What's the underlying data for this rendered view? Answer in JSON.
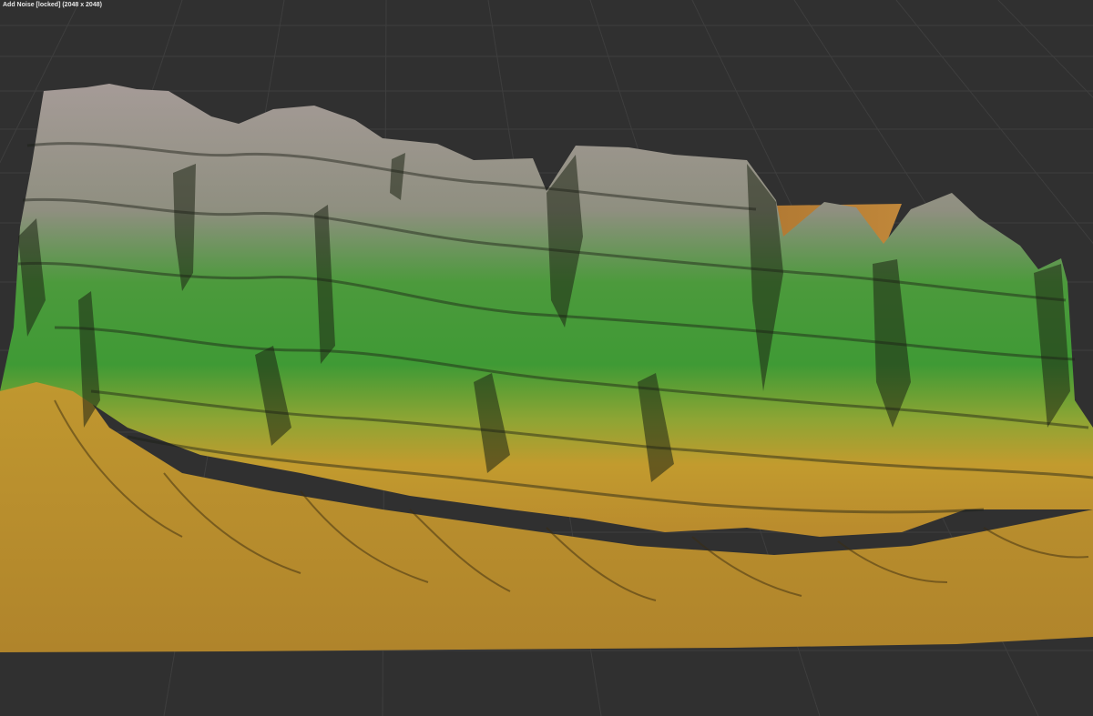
{
  "viewport": {
    "title": "Add Noise [locked] (2048 x 2048)",
    "content": "3d-terrain-heightmap-render",
    "grid": true,
    "colors": {
      "background": "#303030",
      "grid_line": "#3d3d3d",
      "low_elevation": "#c39a2e",
      "mid_elevation": "#3f9f33",
      "high_elevation": "#a49a95",
      "flat_base": "#b07e35"
    }
  }
}
